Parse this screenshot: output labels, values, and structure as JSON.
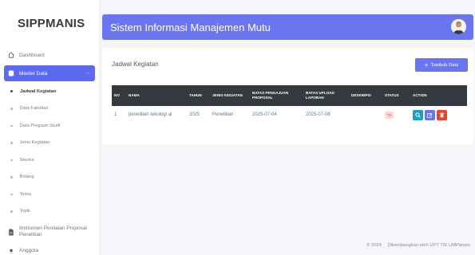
{
  "brand": "SIPPMANIS",
  "sidebar": {
    "items": [
      {
        "label": "Dashboard",
        "icon": "home-icon"
      },
      {
        "label": "Master Data",
        "icon": "database-icon",
        "active": true
      }
    ],
    "sub_items": [
      {
        "label": "Jadwal Kegiatan",
        "active": true
      },
      {
        "label": "Data Fakultas"
      },
      {
        "label": "Data Program Studi"
      },
      {
        "label": "Jenis Kegiatan"
      },
      {
        "label": "Skema"
      },
      {
        "label": "Bidang"
      },
      {
        "label": "Tema"
      },
      {
        "label": "Topik"
      }
    ],
    "instrumen_label": "Instrumen Penilaian Proposal Penelitian",
    "truncated_label": "Anggota"
  },
  "header": {
    "title": "Sistem Informasi Manajemen Mutu"
  },
  "card": {
    "title": "Jadwal Kegiatan",
    "add_button": "Tambah Data",
    "columns": [
      "NO",
      "NAMA",
      "TAHUN",
      "JENIS KEGIATAN",
      "BATAS PENGAJUAN PROPOSAL",
      "BATAS UPLOAD LAPORAN",
      "DESKRIPSI",
      "STATUS",
      "ACTION"
    ],
    "rows": [
      {
        "no": "1",
        "nama": "penelitian tekologi ai",
        "tahun": "2025",
        "jenis": "Penelitian",
        "batas_pengajuan": "2025-07-04",
        "batas_upload": "2025-07-06",
        "deskripsi": "",
        "status": "TA"
      }
    ]
  },
  "footer": {
    "year": "© 2024",
    "credit": "Dikembangkan oleh UPT TIK UMPalopo"
  },
  "colors": {
    "accent": "#6a75f0",
    "header_dark": "#343a40",
    "info": "#17a2b8",
    "danger": "#e8452c"
  }
}
